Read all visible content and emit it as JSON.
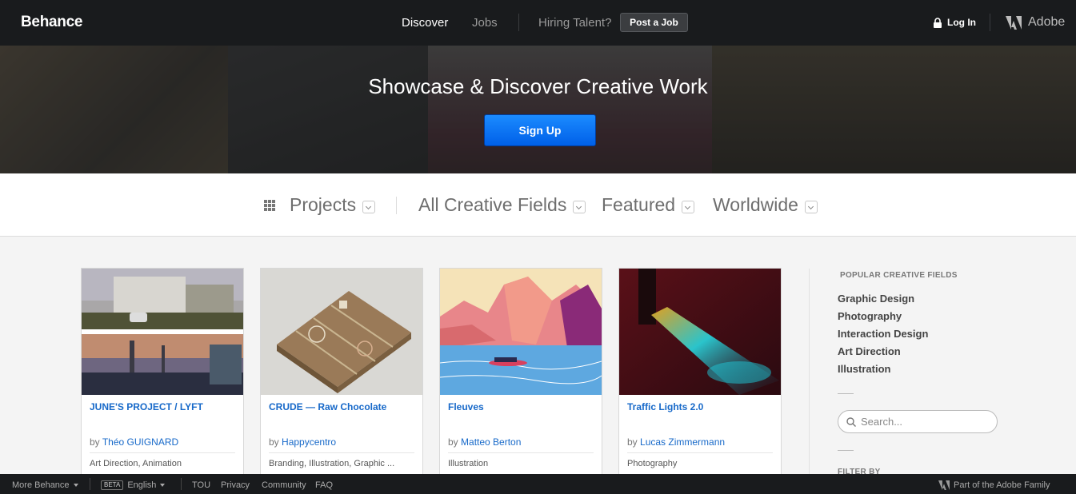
{
  "nav": {
    "logo": "Behance",
    "discover": "Discover",
    "jobs": "Jobs",
    "hiring": "Hiring Talent?",
    "post_job": "Post a Job",
    "login": "Log In",
    "adobe": "Adobe"
  },
  "hero": {
    "title": "Showcase & Discover Creative Work",
    "signup": "Sign Up"
  },
  "filters": {
    "projects": "Projects",
    "fields": "All Creative Fields",
    "featured": "Featured",
    "worldwide": "Worldwide"
  },
  "projects": [
    {
      "title": "JUNE'S PROJECT / LYFT",
      "by": "by",
      "author": "Théo GUIGNARD",
      "fields": "Art Direction, Animation"
    },
    {
      "title": "CRUDE — Raw Chocolate",
      "by": "by",
      "author": "Happycentro",
      "fields": "Branding, Illustration, Graphic ..."
    },
    {
      "title": "Fleuves",
      "by": "by",
      "author": "Matteo Berton",
      "fields": "Illustration"
    },
    {
      "title": "Traffic Lights 2.0",
      "by": "by",
      "author": "Lucas Zimmermann",
      "fields": "Photography"
    }
  ],
  "sidebar": {
    "heading": "POPULAR CREATIVE FIELDS",
    "items": [
      "Graphic Design",
      "Photography",
      "Interaction Design",
      "Art Direction",
      "Illustration"
    ],
    "search_placeholder": "Search...",
    "filter_by": "FILTER BY"
  },
  "footer": {
    "more": "More Behance",
    "beta": "BETA",
    "language": "English",
    "tou": "TOU",
    "privacy": "Privacy",
    "community": "Community",
    "faq": "FAQ",
    "family": "Part of the Adobe Family"
  },
  "colors": {
    "nav_bg": "#191b1d",
    "accent_blue": "#0060e8",
    "link_blue": "#1769c9"
  }
}
